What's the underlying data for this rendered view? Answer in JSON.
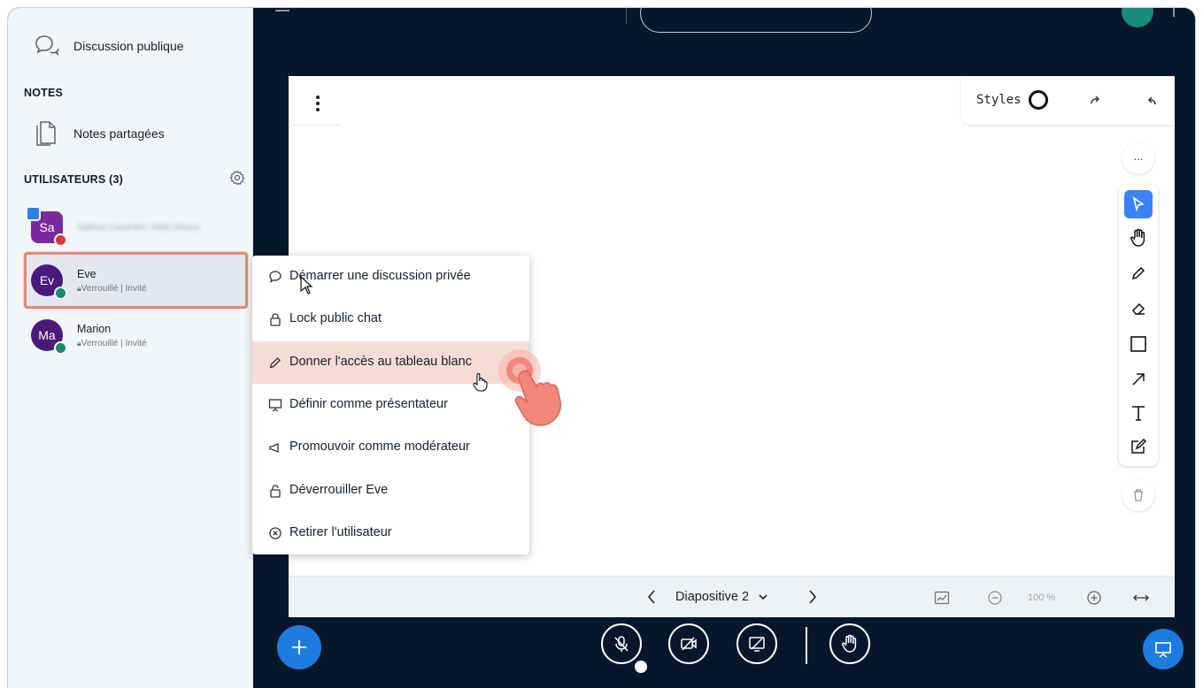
{
  "sidebar": {
    "public_chat_label": "Discussion publique",
    "notes_heading": "NOTES",
    "shared_notes_label": "Notes partagées",
    "users_heading": "UTILISATEURS (3)",
    "users": [
      {
        "initials": "Sa",
        "name": "Sabina Caviedes Vidal (Vous)",
        "role": "",
        "color": "#7b2a9e"
      },
      {
        "initials": "Ev",
        "name": "Eve",
        "role": "Verrouillé | Invité",
        "color": "#4a1a7a"
      },
      {
        "initials": "Ma",
        "name": "Marion",
        "role": "Verrouillé | Invité",
        "color": "#4a1a7a"
      }
    ]
  },
  "context_menu": {
    "items": [
      {
        "label": "Démarrer une discussion privée",
        "icon": "chat-bubble-icon"
      },
      {
        "label": "Lock public chat",
        "icon": "lock-icon"
      },
      {
        "label": "Donner l'accès au tableau blanc",
        "icon": "pencil-icon"
      },
      {
        "label": "Définir comme présentateur",
        "icon": "presentation-icon"
      },
      {
        "label": "Promouvoir comme modérateur",
        "icon": "megaphone-icon"
      },
      {
        "label": "Déverrouiller Eve",
        "icon": "unlock-icon"
      },
      {
        "label": "Retirer l'utilisateur",
        "icon": "remove-circle-icon"
      }
    ]
  },
  "whiteboard": {
    "styles_label": "Styles",
    "more_label": "...",
    "slide_label": "Diapositive 2",
    "zoom_label": "100 %"
  },
  "colors": {
    "accent": "#2f80ed",
    "dark_bg": "#06172a",
    "highlight_border": "#e5877b",
    "active_menu_bg": "#f6dcd6",
    "hand_cursor": "#f0877a"
  }
}
